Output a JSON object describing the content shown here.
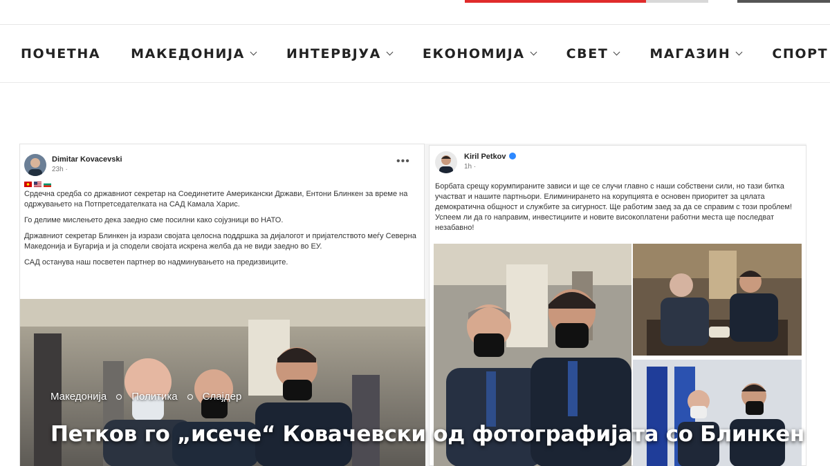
{
  "nav": {
    "items": [
      {
        "label": "ПОЧЕТНА",
        "has_dropdown": false
      },
      {
        "label": "МАКЕДОНИЈА",
        "has_dropdown": true
      },
      {
        "label": "ИНТЕРВЈУА",
        "has_dropdown": true
      },
      {
        "label": "ЕКОНОМИЈА",
        "has_dropdown": true
      },
      {
        "label": "СВЕТ",
        "has_dropdown": true
      },
      {
        "label": "МАГАЗИН",
        "has_dropdown": true
      },
      {
        "label": "СПОРТ",
        "has_dropdown": true
      }
    ]
  },
  "post_left": {
    "author": "Dimitar Kovacevski",
    "time": "23h ·",
    "paragraphs": [
      "Срдечна средба со државниот секретар на Соединетите Американски Држави, Ентони Блинкен за време на одржувањето на Потпретседателката на САД Камала Харис.",
      "Го делиме мислењето дека заедно сме посилни како сојузници во НАТО.",
      "Државниот секретар Блинкен ја изрази својата целосна поддршка за дијалогот и пријателството меѓу Северна Македонија и Бугарија и ја сподели својата искрена желба да не види заедно во ЕУ.",
      "САД останува наш посветен партнер во надминувањето на предизвиците."
    ]
  },
  "post_right": {
    "author": "Kiril Petkov",
    "time": "1h ·",
    "paragraph": "Борбата срещу корумпираните зависи и ще се случи главно с наши собствени сили, но тази битка участват и нашите партньори.  Елиминирането на корупцията е основен приоритет за цялата демократична общност и службите за сигурност.  Ще работим заед за да се справим с този проблем!  Успеем ли да го направим, инвестициите и новите високоплатени работни места ще последват незабавно!"
  },
  "article": {
    "categories": [
      "Македонија",
      "Политика",
      "Слајдер"
    ],
    "headline": "Петков го „исече“ Ковачевски од фотографијата со Блинкен"
  },
  "colors": {
    "accent_red": "#e02b2b",
    "facebook_blue": "#2d88ff"
  }
}
